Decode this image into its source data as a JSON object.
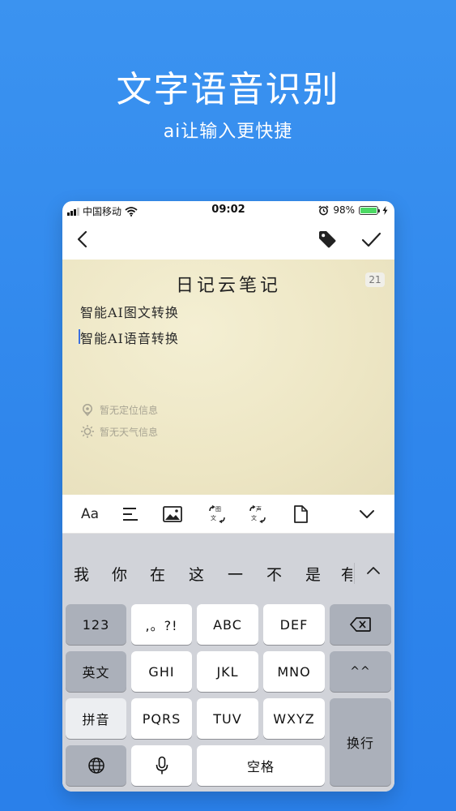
{
  "promo": {
    "headline": "文字语音识别",
    "subline": "ai让输入更快捷"
  },
  "status_bar": {
    "carrier": "中国移动",
    "time": "09:02",
    "battery": "98%",
    "battery_level": 0.98,
    "icons": [
      "signal-icon",
      "wifi-icon",
      "alarm-icon",
      "battery-icon",
      "charging-icon"
    ]
  },
  "nav": {
    "icons": [
      "back-icon",
      "tag-icon",
      "check-icon"
    ]
  },
  "note": {
    "title": "日记云笔记",
    "char_count": "21",
    "lines": [
      "智能AI图文转换",
      "智能AI语音转换"
    ],
    "location": "暂无定位信息",
    "weather": "暂无天气信息"
  },
  "toolbar": {
    "font_label": "Aa",
    "icons": [
      "text-align-icon",
      "image-icon",
      "image-to-text-icon",
      "voice-to-text-icon",
      "document-icon",
      "chevron-down-icon"
    ],
    "ocr_small_top": "图",
    "ocr_small_bottom": "文",
    "voice_small_top": "声",
    "voice_small_bottom": "文"
  },
  "keyboard": {
    "candidates": [
      "我",
      "你",
      "在",
      "这",
      "一",
      "不",
      "是",
      "有"
    ],
    "row1": [
      "123",
      ",。?!",
      "ABC",
      "DEF"
    ],
    "row2": [
      "英文",
      "GHI",
      "JKL",
      "MNO",
      "^^"
    ],
    "row3": [
      "拼音",
      "PQRS",
      "TUV",
      "WXYZ"
    ],
    "return": "换行",
    "space": "空格",
    "icons": [
      "globe-icon",
      "mic-icon",
      "delete-icon",
      "chevron-up-icon"
    ]
  },
  "colors": {
    "background": "#2f86ec",
    "paper": "#ede6c4",
    "keyboard": "#d1d3d9",
    "battery_green": "#4cd964"
  }
}
